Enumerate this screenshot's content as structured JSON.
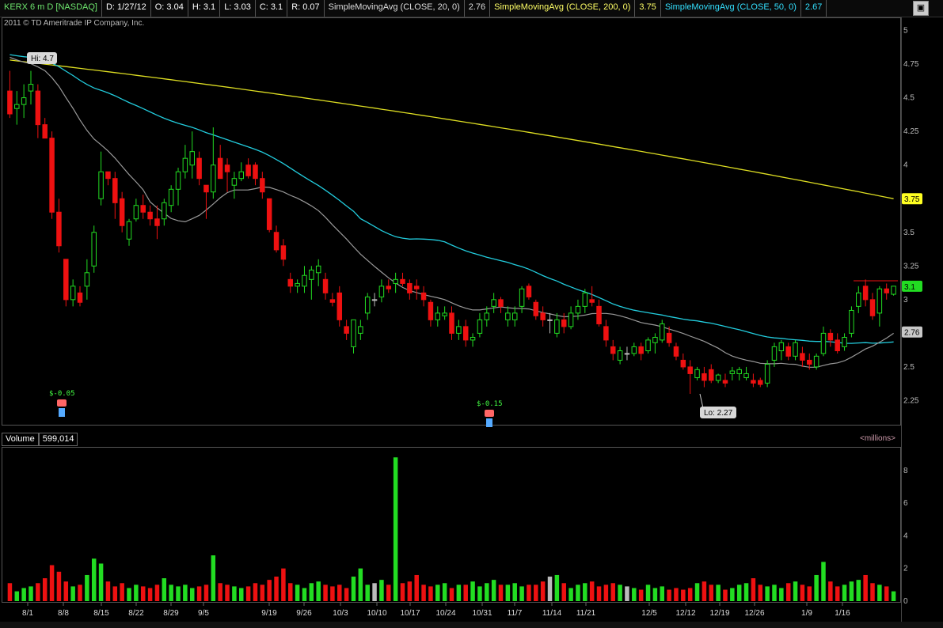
{
  "header": {
    "symbol": "KERX 6 m D [NASDAQ]",
    "date": "D: 1/27/12",
    "open": "O: 3.04",
    "high": "H: 3.1",
    "low": "L: 3.03",
    "close": "C: 3.1",
    "range": "R: 0.07",
    "sma20_label": "SimpleMovingAvg (CLOSE, 20, 0)",
    "sma20_value": "2.76",
    "sma200_label": "SimpleMovingAvg (CLOSE, 200, 0)",
    "sma200_value": "3.75",
    "sma50_label": "SimpleMovingAvg (CLOSE, 50, 0)",
    "sma50_value": "2.67"
  },
  "copyright": "2011 © TD Ameritrade IP Company, Inc.",
  "volume_header": {
    "label": "Volume",
    "value": "599,014",
    "units": "<millions>"
  },
  "colors": {
    "up": "#22dd22",
    "down": "#ee1111",
    "neutral": "#bbbbbb",
    "sma20": "#999999",
    "sma50": "#22ccdd",
    "sma200": "#dddd22"
  },
  "icons": {
    "earnings": "phone-icon",
    "maximize": "maximize-icon"
  },
  "chart_data": {
    "type": "candlestick",
    "x_labels": [
      "8/1",
      "8/8",
      "8/15",
      "8/22",
      "8/29",
      "9/5",
      "9/19",
      "9/26",
      "10/3",
      "10/10",
      "10/17",
      "10/24",
      "10/31",
      "11/7",
      "11/14",
      "11/21",
      "12/5",
      "12/12",
      "12/19",
      "12/26",
      "1/9",
      "1/16"
    ],
    "price_axis": {
      "ticks": [
        "5",
        "4.75",
        "4.5",
        "4.25",
        "4",
        "3.75",
        "3.5",
        "3.25",
        "3",
        "2.75",
        "2.5",
        "2.25"
      ],
      "ylim": [
        2.1,
        5.05
      ]
    },
    "volume_axis": {
      "ticks": [
        "8",
        "6",
        "4",
        "2",
        "0"
      ],
      "ylim": [
        0,
        9.2
      ]
    },
    "annotations": {
      "hi": "Hi: 4.7",
      "lo": "Lo: 2.27",
      "earnings_1": "$-0.05",
      "earnings_2": "$-0.15"
    },
    "price_labels": {
      "sma200": "3.75",
      "last": "3.1",
      "sma20": "2.76"
    },
    "ohlc": [
      [
        4.55,
        4.7,
        4.35,
        4.38
      ],
      [
        4.42,
        4.55,
        4.3,
        4.45
      ],
      [
        4.45,
        4.6,
        4.35,
        4.5
      ],
      [
        4.55,
        4.7,
        4.45,
        4.6
      ],
      [
        4.55,
        4.6,
        4.2,
        4.3
      ],
      [
        4.3,
        4.35,
        4.2,
        4.2
      ],
      [
        4.2,
        4.25,
        3.6,
        3.65
      ],
      [
        3.65,
        3.75,
        3.35,
        3.4
      ],
      [
        3.3,
        3.3,
        2.95,
        3.0
      ],
      [
        3.0,
        3.15,
        2.95,
        3.1
      ],
      [
        3.05,
        3.1,
        2.95,
        2.98
      ],
      [
        3.1,
        3.3,
        3.0,
        3.2
      ],
      [
        3.25,
        3.55,
        3.2,
        3.5
      ],
      [
        3.75,
        4.1,
        3.7,
        3.95
      ],
      [
        3.95,
        3.95,
        3.85,
        3.9
      ],
      [
        3.9,
        3.95,
        3.6,
        3.72
      ],
      [
        3.75,
        3.8,
        3.5,
        3.55
      ],
      [
        3.45,
        3.6,
        3.4,
        3.58
      ],
      [
        3.6,
        3.75,
        3.58,
        3.7
      ],
      [
        3.7,
        3.78,
        3.6,
        3.65
      ],
      [
        3.65,
        3.7,
        3.55,
        3.6
      ],
      [
        3.6,
        3.7,
        3.45,
        3.55
      ],
      [
        3.6,
        3.75,
        3.55,
        3.72
      ],
      [
        3.7,
        3.85,
        3.65,
        3.82
      ],
      [
        3.82,
        3.98,
        3.7,
        3.95
      ],
      [
        3.95,
        4.15,
        3.9,
        4.05
      ],
      [
        4.0,
        4.25,
        3.9,
        4.1
      ],
      [
        4.05,
        4.1,
        3.85,
        3.9
      ],
      [
        3.85,
        3.8,
        3.6,
        3.8
      ],
      [
        3.8,
        4.28,
        3.75,
        4.0
      ],
      [
        4.05,
        4.15,
        3.95,
        3.9
      ],
      [
        4.0,
        4.05,
        3.8,
        3.95
      ],
      [
        3.85,
        3.95,
        3.75,
        3.9
      ],
      [
        3.9,
        4.02,
        3.88,
        3.95
      ],
      [
        4.0,
        4.05,
        3.9,
        3.92
      ],
      [
        4.0,
        4.02,
        3.85,
        3.9
      ],
      [
        3.9,
        3.95,
        3.75,
        3.8
      ],
      [
        3.75,
        3.75,
        3.5,
        3.52
      ],
      [
        3.5,
        3.55,
        3.35,
        3.37
      ],
      [
        3.4,
        3.45,
        3.25,
        3.3
      ],
      [
        3.15,
        3.2,
        3.05,
        3.1
      ],
      [
        3.1,
        3.15,
        3.05,
        3.12
      ],
      [
        3.1,
        3.25,
        3.05,
        3.18
      ],
      [
        3.15,
        3.25,
        3.0,
        3.22
      ],
      [
        3.2,
        3.3,
        3.1,
        3.25
      ],
      [
        3.15,
        3.2,
        3.0,
        3.05
      ],
      [
        3.0,
        3.05,
        2.95,
        2.98
      ],
      [
        3.05,
        3.1,
        2.8,
        2.85
      ],
      [
        2.8,
        2.85,
        2.7,
        2.75
      ],
      [
        2.65,
        2.85,
        2.6,
        2.85
      ],
      [
        2.75,
        2.85,
        2.7,
        2.8
      ],
      [
        2.9,
        3.05,
        2.85,
        3.02
      ],
      [
        3.0,
        3.05,
        2.95,
        3.0
      ],
      [
        3.02,
        3.15,
        2.98,
        3.1
      ],
      [
        3.1,
        3.15,
        3.05,
        3.08
      ],
      [
        3.12,
        3.2,
        3.05,
        3.15
      ],
      [
        3.15,
        3.2,
        3.1,
        3.12
      ],
      [
        3.12,
        3.15,
        3.0,
        3.05
      ],
      [
        3.1,
        3.15,
        3.0,
        3.08
      ],
      [
        3.05,
        3.1,
        2.95,
        3.0
      ],
      [
        2.98,
        3.0,
        2.8,
        2.85
      ],
      [
        2.85,
        2.95,
        2.8,
        2.9
      ],
      [
        2.88,
        2.95,
        2.85,
        2.9
      ],
      [
        2.9,
        2.95,
        2.7,
        2.75
      ],
      [
        2.75,
        2.85,
        2.7,
        2.8
      ],
      [
        2.8,
        2.85,
        2.65,
        2.7
      ],
      [
        2.7,
        2.75,
        2.65,
        2.72
      ],
      [
        2.75,
        2.9,
        2.72,
        2.85
      ],
      [
        2.85,
        2.95,
        2.8,
        2.9
      ],
      [
        2.95,
        3.05,
        2.9,
        3.0
      ],
      [
        3.0,
        3.02,
        2.9,
        2.95
      ],
      [
        2.85,
        2.95,
        2.8,
        2.9
      ],
      [
        2.85,
        2.95,
        2.8,
        2.9
      ],
      [
        2.95,
        3.1,
        2.9,
        3.08
      ],
      [
        3.1,
        3.12,
        3.0,
        3.02
      ],
      [
        2.98,
        3.0,
        2.85,
        2.88
      ],
      [
        2.9,
        2.95,
        2.8,
        2.85
      ],
      [
        2.85,
        2.9,
        2.75,
        2.85
      ],
      [
        2.75,
        2.9,
        2.72,
        2.85
      ],
      [
        2.85,
        2.9,
        2.75,
        2.8
      ],
      [
        2.8,
        2.95,
        2.78,
        2.9
      ],
      [
        2.9,
        3.0,
        2.85,
        2.95
      ],
      [
        2.95,
        3.08,
        2.9,
        3.05
      ],
      [
        3.0,
        3.1,
        2.95,
        2.98
      ],
      [
        2.95,
        3.0,
        2.8,
        2.82
      ],
      [
        2.8,
        2.85,
        2.65,
        2.7
      ],
      [
        2.65,
        2.7,
        2.55,
        2.6
      ],
      [
        2.55,
        2.65,
        2.52,
        2.62
      ],
      [
        2.6,
        2.65,
        2.55,
        2.6
      ],
      [
        2.6,
        2.68,
        2.58,
        2.65
      ],
      [
        2.65,
        2.68,
        2.55,
        2.6
      ],
      [
        2.62,
        2.72,
        2.6,
        2.7
      ],
      [
        2.68,
        2.75,
        2.6,
        2.72
      ],
      [
        2.7,
        2.85,
        2.68,
        2.82
      ],
      [
        2.75,
        2.8,
        2.65,
        2.68
      ],
      [
        2.65,
        2.68,
        2.55,
        2.58
      ],
      [
        2.55,
        2.6,
        2.48,
        2.5
      ],
      [
        2.5,
        2.55,
        2.3,
        2.45
      ],
      [
        2.42,
        2.5,
        2.4,
        2.48
      ],
      [
        2.45,
        2.5,
        2.35,
        2.4
      ],
      [
        2.48,
        2.52,
        2.38,
        2.4
      ],
      [
        2.4,
        2.45,
        2.38,
        2.44
      ],
      [
        2.4,
        2.45,
        2.35,
        2.38
      ],
      [
        2.45,
        2.5,
        2.4,
        2.47
      ],
      [
        2.45,
        2.5,
        2.4,
        2.48
      ],
      [
        2.42,
        2.5,
        2.4,
        2.45
      ],
      [
        2.4,
        2.45,
        2.35,
        2.38
      ],
      [
        2.4,
        2.42,
        2.35,
        2.37
      ],
      [
        2.38,
        2.55,
        2.35,
        2.52
      ],
      [
        2.55,
        2.68,
        2.5,
        2.65
      ],
      [
        2.62,
        2.7,
        2.55,
        2.68
      ],
      [
        2.65,
        2.68,
        2.55,
        2.58
      ],
      [
        2.58,
        2.7,
        2.55,
        2.68
      ],
      [
        2.6,
        2.65,
        2.5,
        2.55
      ],
      [
        2.55,
        2.6,
        2.48,
        2.52
      ],
      [
        2.5,
        2.6,
        2.48,
        2.58
      ],
      [
        2.6,
        2.8,
        2.58,
        2.75
      ],
      [
        2.75,
        2.78,
        2.65,
        2.7
      ],
      [
        2.7,
        2.75,
        2.6,
        2.62
      ],
      [
        2.65,
        2.75,
        2.62,
        2.72
      ],
      [
        2.75,
        2.95,
        2.72,
        2.92
      ],
      [
        2.95,
        3.1,
        2.9,
        3.05
      ],
      [
        3.1,
        3.15,
        2.95,
        3.0
      ],
      [
        3.0,
        3.05,
        2.85,
        2.88
      ],
      [
        2.9,
        3.1,
        2.8,
        3.08
      ],
      [
        3.08,
        3.12,
        3.0,
        3.05
      ],
      [
        3.04,
        3.1,
        3.03,
        3.1
      ]
    ],
    "volume": [
      1.1,
      0.6,
      0.8,
      0.9,
      1.1,
      1.4,
      2.2,
      1.8,
      1.2,
      0.9,
      1.0,
      1.6,
      2.6,
      2.3,
      1.2,
      0.9,
      1.1,
      0.8,
      1.0,
      0.9,
      0.8,
      1.0,
      1.4,
      1.0,
      0.9,
      1.0,
      0.8,
      0.9,
      1.0,
      2.8,
      1.1,
      1.0,
      0.9,
      0.8,
      0.9,
      1.1,
      1.0,
      1.3,
      1.5,
      2.0,
      1.1,
      1.0,
      0.8,
      1.1,
      1.2,
      1.0,
      0.9,
      1.0,
      0.8,
      1.5,
      2.0,
      1.0,
      1.1,
      1.3,
      1.0,
      0.9,
      1.1,
      1.2,
      1.6,
      1.0,
      0.9,
      1.0,
      1.1,
      0.8,
      1.0,
      1.0,
      1.2,
      0.9,
      1.1,
      1.3,
      1.0,
      1.0,
      1.1,
      0.9,
      1.0,
      1.0,
      1.2,
      1.5,
      1.6,
      1.1,
      0.8,
      1.0,
      1.1,
      1.2,
      0.9,
      1.0,
      1.1,
      1.0,
      0.9,
      0.8,
      0.7,
      1.0,
      0.8,
      0.9,
      0.7,
      0.8,
      0.7,
      0.8,
      1.1,
      1.2,
      1.0,
      1.0,
      0.7,
      0.8,
      1.0,
      1.1,
      1.4,
      1.0,
      0.9,
      1.0,
      0.8,
      1.1,
      1.2,
      1.0,
      0.9,
      1.6,
      2.4,
      1.2,
      0.9,
      1.0,
      1.2,
      1.3,
      1.6,
      1.1,
      1.0,
      0.9,
      0.6
    ],
    "vol_spike_index": 55,
    "vol_spike_value": 8.8
  }
}
